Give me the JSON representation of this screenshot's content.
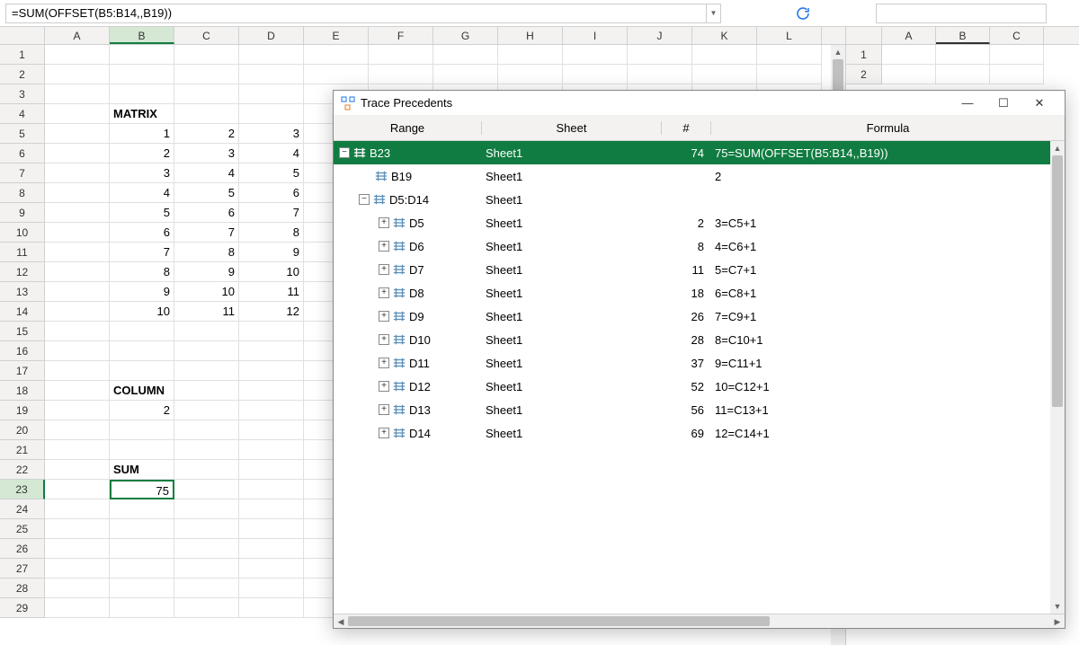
{
  "formula_bar": {
    "value": "=SUM(OFFSET(B5:B14,,B19))"
  },
  "left_sheet": {
    "columns": [
      "A",
      "B",
      "C",
      "D",
      "E",
      "F",
      "G",
      "H",
      "I",
      "J",
      "K",
      "L"
    ],
    "selected_col": "B",
    "selected_row": 23,
    "rows": 29,
    "labels": {
      "matrix": "MATRIX",
      "column": "COLUMN",
      "sum": "SUM"
    },
    "cells": {
      "B4": "MATRIX",
      "B5": "1",
      "C5": "2",
      "D5": "3",
      "B6": "2",
      "C6": "3",
      "D6": "4",
      "B7": "3",
      "C7": "4",
      "D7": "5",
      "B8": "4",
      "C8": "5",
      "D8": "6",
      "B9": "5",
      "C9": "6",
      "D9": "7",
      "B10": "6",
      "C10": "7",
      "D10": "8",
      "B11": "7",
      "C11": "8",
      "D11": "9",
      "B12": "8",
      "C12": "9",
      "D12": "10",
      "B13": "9",
      "C13": "10",
      "D13": "11",
      "B14": "10",
      "C14": "11",
      "D14": "12",
      "B18": "COLUMN",
      "B19": "2",
      "B22": "SUM",
      "B23": "75"
    }
  },
  "right_sheet": {
    "columns": [
      "A",
      "B",
      "C"
    ],
    "selected_col": "B",
    "rows": [
      1,
      2
    ]
  },
  "dialog": {
    "title": "Trace Precedents",
    "headers": {
      "range": "Range",
      "sheet": "Sheet",
      "num": "#",
      "formula": "Formula"
    },
    "rows": [
      {
        "level": 0,
        "expand": "-",
        "range": "B23",
        "sheet": "Sheet1",
        "num": "74",
        "formula": "75=SUM(OFFSET(B5:B14,,B19))",
        "selected": true
      },
      {
        "level": 1,
        "expand": "",
        "range": "B19",
        "sheet": "Sheet1",
        "num": "",
        "formula": "2"
      },
      {
        "level": 1,
        "expand": "-",
        "range": "D5:D14",
        "sheet": "Sheet1",
        "num": "",
        "formula": ""
      },
      {
        "level": 2,
        "expand": "+",
        "range": "D5",
        "sheet": "Sheet1",
        "num": "2",
        "formula": "3=C5+1"
      },
      {
        "level": 2,
        "expand": "+",
        "range": "D6",
        "sheet": "Sheet1",
        "num": "8",
        "formula": "4=C6+1"
      },
      {
        "level": 2,
        "expand": "+",
        "range": "D7",
        "sheet": "Sheet1",
        "num": "11",
        "formula": "5=C7+1"
      },
      {
        "level": 2,
        "expand": "+",
        "range": "D8",
        "sheet": "Sheet1",
        "num": "18",
        "formula": "6=C8+1"
      },
      {
        "level": 2,
        "expand": "+",
        "range": "D9",
        "sheet": "Sheet1",
        "num": "26",
        "formula": "7=C9+1"
      },
      {
        "level": 2,
        "expand": "+",
        "range": "D10",
        "sheet": "Sheet1",
        "num": "28",
        "formula": "8=C10+1"
      },
      {
        "level": 2,
        "expand": "+",
        "range": "D11",
        "sheet": "Sheet1",
        "num": "37",
        "formula": "9=C11+1"
      },
      {
        "level": 2,
        "expand": "+",
        "range": "D12",
        "sheet": "Sheet1",
        "num": "52",
        "formula": "10=C12+1"
      },
      {
        "level": 2,
        "expand": "+",
        "range": "D13",
        "sheet": "Sheet1",
        "num": "56",
        "formula": "11=C13+1"
      },
      {
        "level": 2,
        "expand": "+",
        "range": "D14",
        "sheet": "Sheet1",
        "num": "69",
        "formula": "12=C14+1"
      }
    ]
  }
}
